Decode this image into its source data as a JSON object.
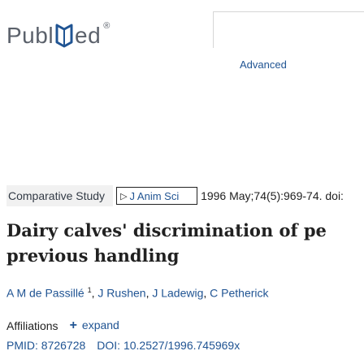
{
  "logo": {
    "pub": "Publ",
    "ed": "ed",
    "reg": "®"
  },
  "search": {
    "advanced_label": "Advanced",
    "input_value": ""
  },
  "article": {
    "publication_type": "Comparative Study",
    "journal_button": "J Anim Sci",
    "citation": "1996 May;74(5):969-74. doi:",
    "title_line1": "Dairy calves' discrimination of pe",
    "title_line2": "previous handling",
    "authors": [
      {
        "name": "A M de Passillé",
        "sup": "1"
      },
      {
        "name": "J Rushen"
      },
      {
        "name": "J Ladewig"
      },
      {
        "name": "C Petherick"
      }
    ],
    "affiliations_label": "Affiliations",
    "expand_label": "expand",
    "pmid_label": "PMID: 8726728",
    "doi_label": "DOI: 10.2527/1996.745969x"
  },
  "colors": {
    "link": "#205493",
    "text": "#212121",
    "logo": "#5b616b",
    "badge_bg": "#f1f1f1"
  },
  "icons": {
    "logo_mark": "pubmed-book-icon",
    "journal_arrow": "triangle-right-icon",
    "expand": "plus-icon"
  }
}
